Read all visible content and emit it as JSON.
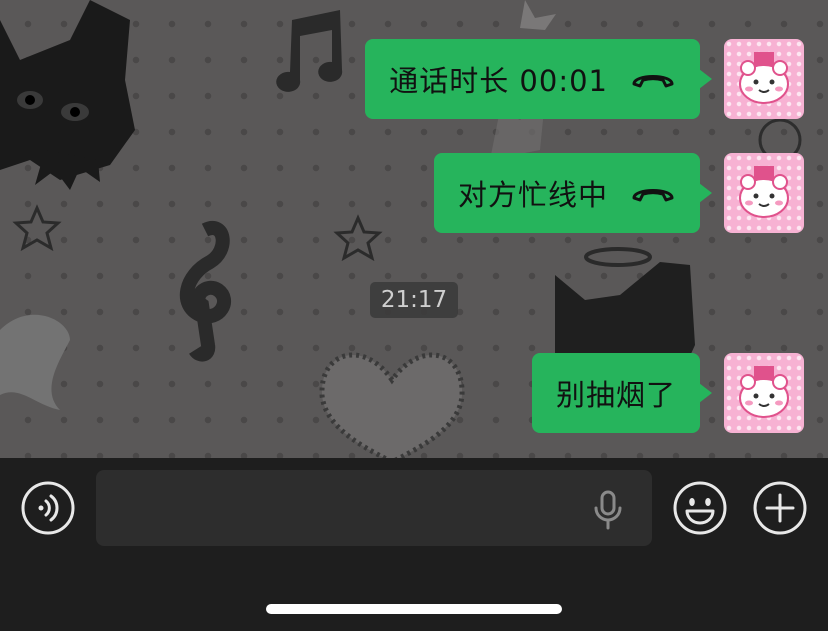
{
  "messages": [
    {
      "text": "通话时长 00:01",
      "kind": "call",
      "icon": "phone-hangup-icon"
    },
    {
      "text": "对方忙线中",
      "kind": "call",
      "icon": "phone-hangup-icon"
    },
    {
      "text": "别抽烟了",
      "kind": "text"
    }
  ],
  "timestamp": "21:17",
  "input": {
    "voice_icon": "voice-wave-icon",
    "mic_icon": "microphone-icon",
    "emoji_icon": "smiley-icon",
    "more_icon": "plus-circle-icon"
  },
  "colors": {
    "bubble": "#26b45c",
    "input_bar": "#1e1e1e",
    "wallpaper": "#5a5858",
    "avatar": "#f7b2d3"
  }
}
